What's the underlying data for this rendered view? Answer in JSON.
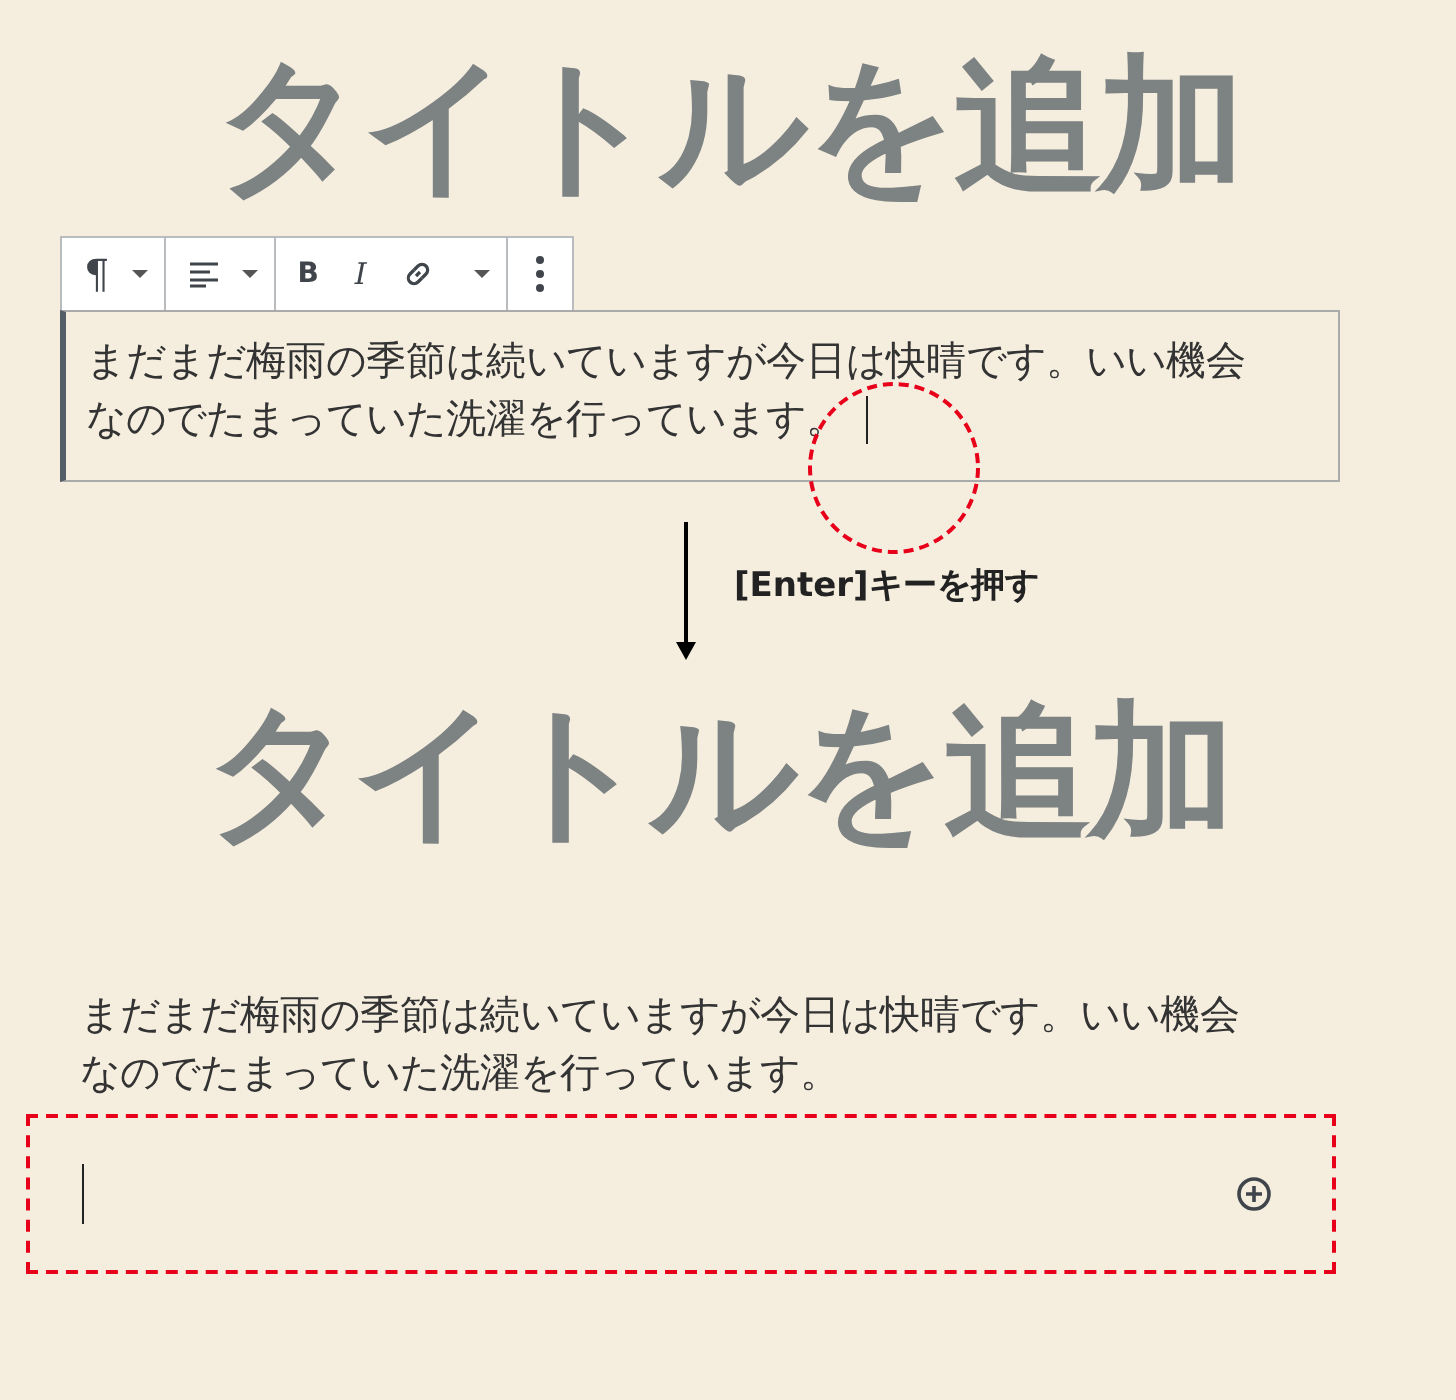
{
  "before": {
    "title": "タイトルを追加",
    "toolbar": [
      {
        "items": [
          {
            "kind": "paragraph",
            "label": "¶"
          },
          {
            "kind": "caret"
          }
        ]
      },
      {
        "items": [
          {
            "kind": "align"
          },
          {
            "kind": "caret"
          }
        ]
      },
      {
        "items": [
          {
            "kind": "bold",
            "label": "B"
          },
          {
            "kind": "italic",
            "label": "I"
          },
          {
            "kind": "link"
          },
          {
            "kind": "caret"
          }
        ]
      },
      {
        "items": [
          {
            "kind": "more"
          }
        ]
      }
    ],
    "paragraph": {
      "lines": [
        "まだまだ梅雨の季節は続いていますが今日は快晴です。いい機会",
        "なのでたまっていた洗濯を行っています。"
      ],
      "caret": true
    }
  },
  "step": {
    "label": "[Enter]キーを押す"
  },
  "after": {
    "title": "タイトルを追加",
    "paragraph": {
      "lines": [
        "まだまだ梅雨の季節は続いていますが今日は快晴です。いい機会",
        "なのでたまっていた洗濯を行っています。"
      ]
    },
    "new_block": {
      "caret": true
    }
  }
}
